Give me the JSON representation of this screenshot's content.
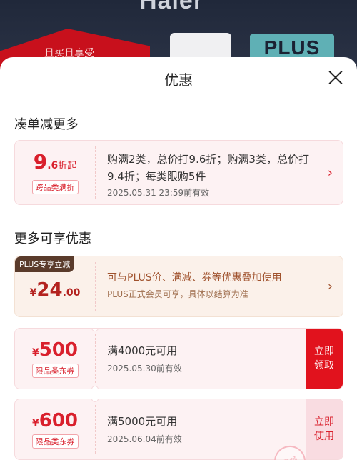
{
  "banner": {
    "brand": "Haier",
    "promo_text": "且买且享受",
    "plus_badge": "PLUS"
  },
  "sheet": {
    "title": "优惠",
    "section_more_orders": "凑单减更多",
    "section_more_discounts": "更多可享优惠"
  },
  "cross_category": {
    "discount_main": "9",
    "discount_decimal": ".6",
    "discount_suffix": "折起",
    "tag": "跨品类满折",
    "description": "购满2类，总价打9.6折；购满3类，总价打9.4折；每类限购5件",
    "expiry": "2025.05.31  23:59前有效"
  },
  "plus_offer": {
    "tag": "PLUS专享立减",
    "currency": "¥",
    "amount_int": "24",
    "amount_dec": ".00",
    "line1": "可与PLUS价、满减、券等优惠叠加使用",
    "line2": "PLUS正式会员可享，具体以结算为准"
  },
  "coupons": [
    {
      "currency": "¥",
      "amount": "500",
      "tag": "限品类东券",
      "condition": "满4000元可用",
      "expiry": "2025.05.30前有效",
      "action_line1": "立即",
      "action_line2": "领取"
    },
    {
      "currency": "¥",
      "amount": "600",
      "tag": "限品类东券",
      "condition": "满5000元可用",
      "expiry": "2025.06.04前有效",
      "action_line1": "立即",
      "action_line2": "使用",
      "stamp": "已领"
    }
  ]
}
